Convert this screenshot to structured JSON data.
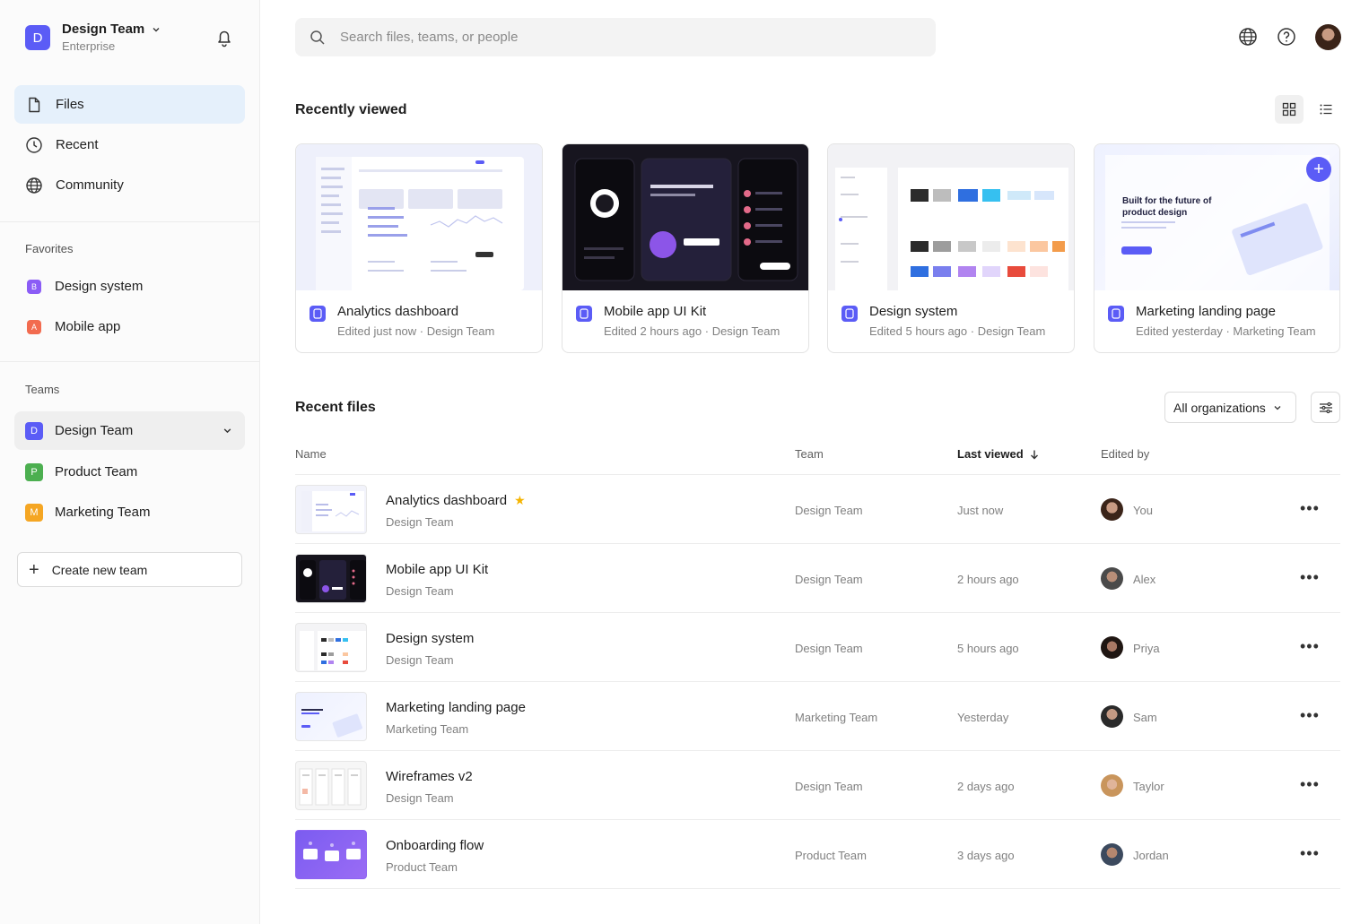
{
  "workspace": {
    "initial": "D",
    "name": "Design Team",
    "plan": "Enterprise",
    "color": "#5b5cf6"
  },
  "nav": [
    {
      "label": "Files",
      "icon": "file-icon",
      "active": true
    },
    {
      "label": "Recent",
      "icon": "clock-icon",
      "active": false
    },
    {
      "label": "Community",
      "icon": "globe-icon",
      "active": false
    }
  ],
  "favorites": {
    "label": "Favorites",
    "items": [
      {
        "label": "Design system",
        "color": "#8b5cf6"
      },
      {
        "label": "Mobile app",
        "color": "#f26b4f"
      }
    ]
  },
  "teams": {
    "label": "Teams",
    "items": [
      {
        "initial": "D",
        "label": "Design Team",
        "color": "#5b5cf6",
        "active": true
      },
      {
        "initial": "P",
        "label": "Product Team",
        "color": "#4caf50",
        "active": false
      },
      {
        "initial": "M",
        "label": "Marketing Team",
        "color": "#f5a623",
        "active": false
      }
    ],
    "create_label": "Create new team"
  },
  "search": {
    "placeholder": "Search files, teams, or people"
  },
  "recently_viewed": {
    "title": "Recently viewed",
    "cards": [
      {
        "title": "Analytics dashboard",
        "meta": "Edited just now · Design Team"
      },
      {
        "title": "Mobile app UI Kit",
        "meta": "Edited 2 hours ago · Design Team"
      },
      {
        "title": "Design system",
        "meta": "Edited 5 hours ago · Design Team"
      },
      {
        "title": "Marketing landing page",
        "meta": "Edited yesterday · Marketing Team",
        "thumb_heading": "Built for the future of product design"
      }
    ]
  },
  "recent_files": {
    "title": "Recent files",
    "org_filter": "All organizations",
    "columns": {
      "name": "Name",
      "team": "Team",
      "last_viewed": "Last viewed",
      "edited_by": "Edited by"
    },
    "rows": [
      {
        "name": "Analytics dashboard",
        "team": "Design Team",
        "time": "Just now",
        "editor": "You",
        "starred": true
      },
      {
        "name": "Mobile app UI Kit",
        "team": "Design Team",
        "time": "2 hours ago",
        "editor": "Alex",
        "starred": false
      },
      {
        "name": "Design system",
        "team": "Design Team",
        "time": "5 hours ago",
        "editor": "Priya",
        "starred": false
      },
      {
        "name": "Marketing landing page",
        "team": "Marketing Team",
        "time": "Yesterday",
        "editor": "Sam",
        "starred": false
      },
      {
        "name": "Wireframes v2",
        "team": "Design Team",
        "time": "2 days ago",
        "editor": "Taylor",
        "starred": false
      },
      {
        "name": "Onboarding flow",
        "team": "Product Team",
        "time": "3 days ago",
        "editor": "Jordan",
        "starred": false
      }
    ]
  }
}
